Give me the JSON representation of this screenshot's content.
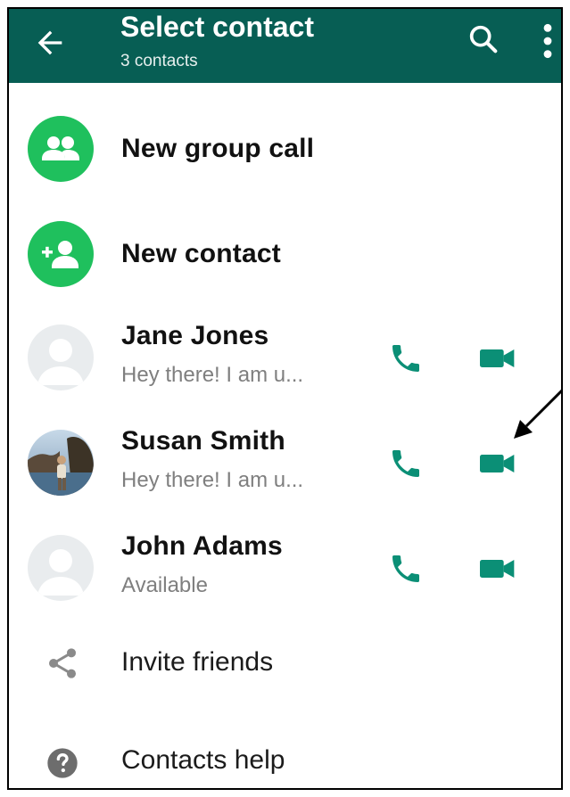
{
  "header": {
    "title": "Select contact",
    "subtitle": "3 contacts",
    "icons": [
      "back-arrow-icon",
      "search-icon",
      "more-vert-icon"
    ]
  },
  "actions": [
    {
      "label": "New group call",
      "icon": "group-icon"
    },
    {
      "label": "New contact",
      "icon": "add-person-icon"
    }
  ],
  "contacts": [
    {
      "name": "Jane Jones",
      "status": "Hey there! I am u...",
      "avatar": "default-avatar"
    },
    {
      "name": "Susan Smith",
      "status": "Hey there! I am u...",
      "avatar": "photo-avatar"
    },
    {
      "name": "John Adams",
      "status": "Available",
      "avatar": "default-avatar"
    }
  ],
  "footer_items": [
    {
      "label": "Invite friends",
      "icon": "share-icon"
    },
    {
      "label": "Contacts help",
      "icon": "help-icon"
    }
  ],
  "colors": {
    "appbar": "#075e54",
    "accent_green": "#1fc05d",
    "icon_teal": "#0b8f76"
  }
}
